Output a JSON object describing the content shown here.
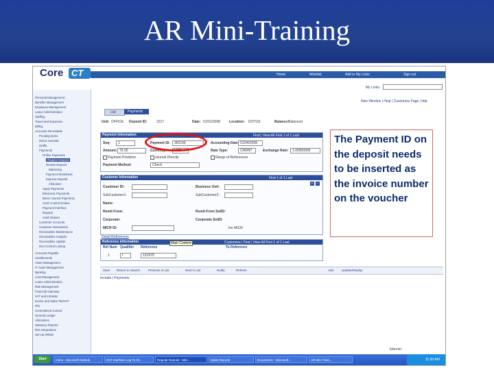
{
  "slide": {
    "title": "AR Mini-Training"
  },
  "callout": {
    "text": "The Payment ID on the deposit needs to be inserted as the invoice number on the voucher"
  },
  "app": {
    "logo_text": "Core",
    "logo_ct": "CT",
    "nav": [
      "Home",
      "Worklist",
      "Add to My Links",
      "Sign out"
    ],
    "my_links": "My Links:",
    "top_links": "New Window | Help | Customize Page | http"
  },
  "menu": {
    "items": [
      "Personal Management",
      "Benefits Management",
      "Employee Management",
      "Leave Administration",
      "Staffing",
      "Travel and Expenses",
      "Billing",
      "Accounts Receivable",
      "Pending Items",
      "Direct Journals",
      "Drafts",
      "Payments",
      "Online Payments",
      "Regular Deposit",
      "Review Deposit",
      "Balancing",
      "Payment Worksheet",
      "Express Deposit",
      "Allocation",
      "Apply Payments",
      "Electronic Payments",
      "Direct Journal Payments",
      "Cash Control Entries",
      "Payment Interface",
      "Reports",
      "Cash Drawer",
      "Customer Accounts",
      "Customer Interactions",
      "Receivables Maintenance",
      "Receivables Analysis",
      "Receivables Update",
      "Run Control Lookup",
      "Accounts Payable",
      "eSettlements",
      "Asset Management",
      "IT Asset Management",
      "Banking",
      "Cost Management",
      "Lease Administration",
      "Risk Management",
      "Financial Gateway",
      "VAT and Intrastat",
      "Excise and Sales Tax/VAT",
      "IRS",
      "Commitment Control",
      "General Ledger",
      "Allocations",
      "Statutory Reports",
      "EDI Integrations",
      "Set Up HRMS"
    ]
  },
  "tabs": {
    "list": "List",
    "payments": "Payments"
  },
  "deposit": {
    "unit_label": "Unit:",
    "unit_value": "OFFICE",
    "deposit_id_label": "Deposit ID:",
    "deposit_id_value": "2217",
    "date_label": "Date:",
    "date_value": "01/01/2008",
    "location_label": "Location:",
    "location_value": "DOTUS",
    "balance_label": "Balance:",
    "balance_value": "Balanced"
  },
  "payment_info": {
    "header": "Payment Information",
    "nav": "Find | View All   First 1 of 1 Last",
    "seq_label": "Seq:",
    "seq_value": "1",
    "payment_id_label": "Payment ID:",
    "payment_id_value": "963166",
    "accounting_date_label": "Accounting Date:",
    "accounting_date_value": "01/04/2008",
    "amount_label": "Amount:",
    "amount_value": "75.00",
    "currency_label": "Currency:",
    "currency_value": "USD",
    "rate_type_label": "Rate Type:",
    "rate_type_value": "CRRNT",
    "exchange_rate_label": "Exchange Rate:",
    "exchange_rate_value": "1.00000000",
    "predictor_label": "Payment Predictor",
    "journal_label": "Journal Directly",
    "range_label": "Range of References",
    "method_label": "Payment Method:",
    "method_value": "Check"
  },
  "customer_info": {
    "header": "Customer Information",
    "nav": "First   1 of 1   Last",
    "customer_id": "Customer ID:",
    "business_unit": "Business Unit:",
    "subcustomer1": "SubCustomer1:",
    "subcustomer2": "SubCustomer2:",
    "name": "Name:",
    "remit_from": "Remit From:",
    "remit_from_setid": "Remit From SetID:",
    "corporate": "Corporate:",
    "corporate_setid": "Corporate SetID:",
    "micr": "MICR ID:",
    "micr_setid": "Inv MICR",
    "detail_refs": "Detail References"
  },
  "ref_info": {
    "header": "Reference Information",
    "tooltip": "Main Content",
    "nav": "Customize | Find | View All   First 1 of 1 Last",
    "col_ref_num": "Ref Num",
    "col_qualifier": "Qualifier",
    "col_reference": "Reference",
    "col_to_ref": "To Reference",
    "row_num": "1",
    "row_qualifier": "I",
    "row_reference": "131979"
  },
  "buttons": [
    "Save",
    "Return to Search",
    "Previous in List",
    "Next in List",
    "Notify",
    "Refresh",
    "Add",
    "Update/Display"
  ],
  "payments_link": "Include | Payments",
  "taskbar": {
    "start": "Start",
    "tasks": [
      "Inbox - Microsoft Outlook",
      "EST Interface Log To Ol...",
      "Regular Deposit - Micr...",
      "Sales Reports",
      "Document1 - Microsoft...",
      "AR Mini Train..."
    ],
    "clock": "11:50 AM",
    "status": "Internet"
  }
}
